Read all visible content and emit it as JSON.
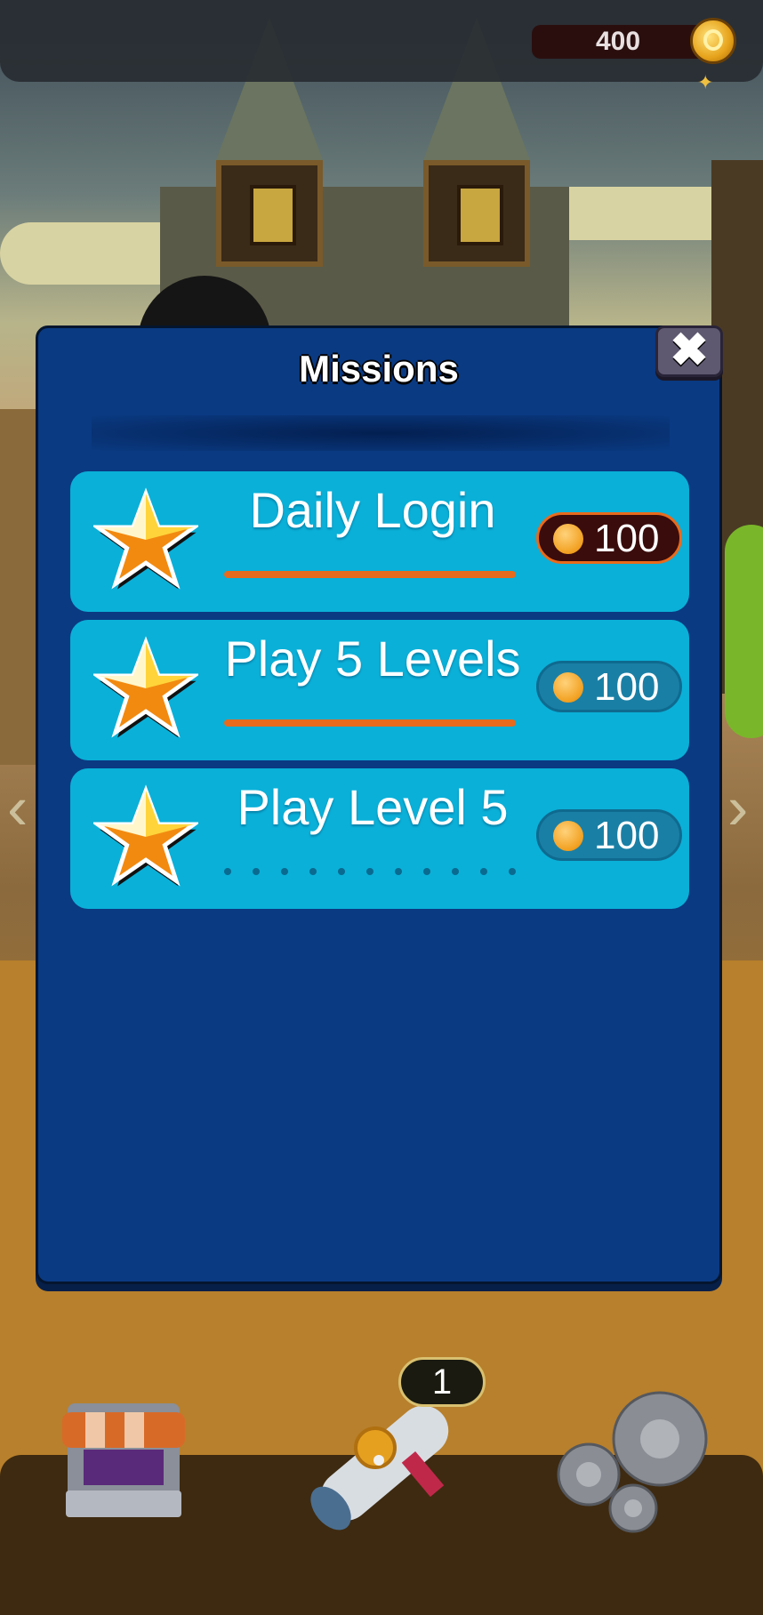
{
  "currency": {
    "coins": "400",
    "coin_icon": "gold-coin-icon"
  },
  "dialog": {
    "title": "Missions",
    "close_label": "✖",
    "missions": [
      {
        "name": "Daily Login",
        "reward": "100",
        "progress": 1.0,
        "claimable": true
      },
      {
        "name": "Play 5 Levels",
        "reward": "100",
        "progress": 1.0,
        "claimable": false
      },
      {
        "name": "Play Level 5",
        "reward": "100",
        "progress": 0.0,
        "claimable": false
      }
    ]
  },
  "bottom_nav": {
    "shop_icon": "shop-icon",
    "missions_icon": "scroll-icon",
    "missions_badge": "1",
    "settings_icon": "gears-icon"
  },
  "colors": {
    "dialog_bg": "#0a3a82",
    "mission_bg": "#0ab0d8",
    "progress": "#e86a1c",
    "claim_border": "#e86a1c"
  }
}
